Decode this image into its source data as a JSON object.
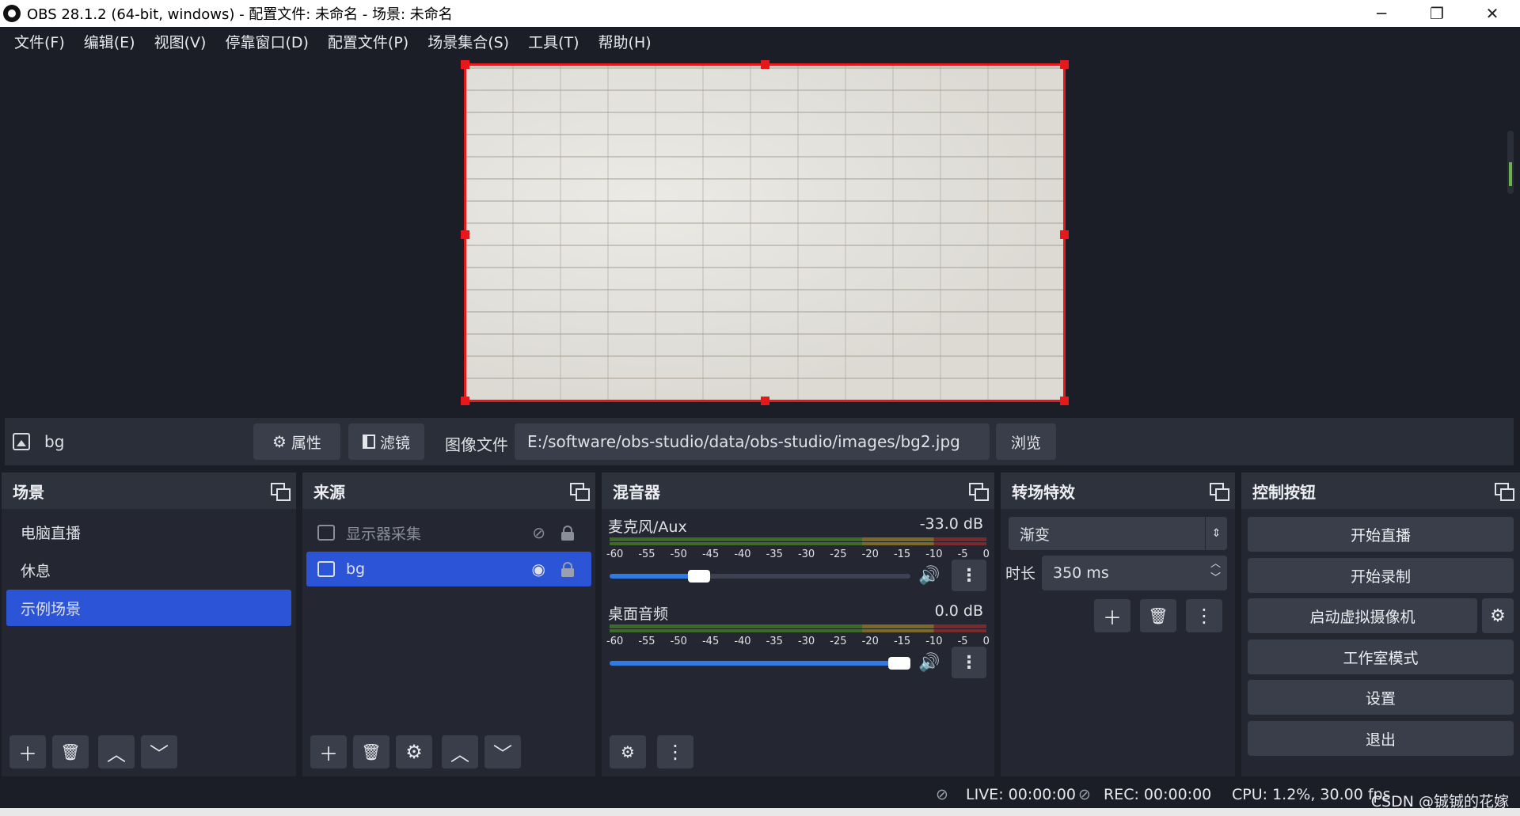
{
  "window": {
    "title": "OBS 28.1.2 (64-bit, windows) - 配置文件: 未命名 - 场景: 未命名",
    "minimize": "─",
    "restore": "❐",
    "close": "✕"
  },
  "menu": [
    "文件(F)",
    "编辑(E)",
    "视图(V)",
    "停靠窗口(D)",
    "配置文件(P)",
    "场景集合(S)",
    "工具(T)",
    "帮助(H)"
  ],
  "source_toolbar": {
    "name": "bg",
    "properties": "属性",
    "filters": "滤镜",
    "image_file_label": "图像文件",
    "path": "E:/software/obs-studio/data/obs-studio/images/bg2.jpg",
    "browse": "浏览"
  },
  "scenes": {
    "title": "场景",
    "items": [
      {
        "label": "电脑直播",
        "active": false
      },
      {
        "label": "休息",
        "active": false
      },
      {
        "label": "示例场景",
        "active": true
      }
    ]
  },
  "sources": {
    "title": "来源",
    "items": [
      {
        "label": "显示器采集",
        "visible": false,
        "locked": true,
        "active": false
      },
      {
        "label": "bg",
        "visible": true,
        "locked": true,
        "active": true
      }
    ]
  },
  "mixer": {
    "title": "混音器",
    "channels": [
      {
        "name": "麦克风/Aux",
        "db": "-33.0 dB",
        "volume": 0.28
      },
      {
        "name": "桌面音频",
        "db": "0.0 dB",
        "volume": 1.0
      }
    ],
    "ticks": [
      "-60",
      "-55",
      "-50",
      "-45",
      "-40",
      "-35",
      "-30",
      "-25",
      "-20",
      "-15",
      "-10",
      "-5",
      "0"
    ]
  },
  "transitions": {
    "title": "转场特效",
    "selected": "渐变",
    "duration_label": "时长",
    "duration": "350 ms"
  },
  "controls": {
    "title": "控制按钮",
    "start_stream": "开始直播",
    "start_record": "开始录制",
    "virtual_cam": "启动虚拟摄像机",
    "studio_mode": "工作室模式",
    "settings": "设置",
    "exit": "退出"
  },
  "status": {
    "live": "LIVE: 00:00:00",
    "rec": "REC: 00:00:00",
    "cpu": "CPU: 1.2%, 30.00 fps"
  },
  "watermark": "CSDN @铖铖的花嫁"
}
